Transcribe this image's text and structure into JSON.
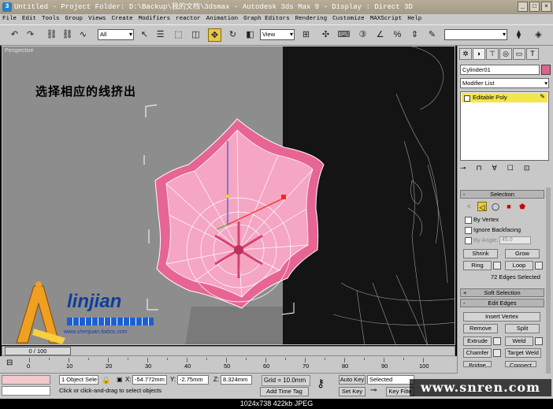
{
  "window": {
    "title": "Untitled     - Project Folder: D:\\Backup\\我的文档\\3dsmax     - Autodesk 3ds Max 9     - Display : Direct 3D",
    "controls": [
      "_",
      "□",
      "×"
    ]
  },
  "menu": [
    "File",
    "Edit",
    "Tools",
    "Group",
    "Views",
    "Create",
    "Modifiers",
    "reactor",
    "Animation",
    "Graph Editors",
    "Rendering",
    "Customize",
    "MAXScript",
    "Help"
  ],
  "toolbar": {
    "selection_filter": "All",
    "ref_coord": "View"
  },
  "viewport": {
    "label": "Perspective",
    "caption": "选择相应的线挤出"
  },
  "logo": {
    "text": "linjian",
    "url": "www.shenjuan.fwbos.com"
  },
  "command_panel": {
    "object_name": "Cylinder01",
    "modifier_list": "Modifier List",
    "stack_item": "Editable Poly",
    "selection": {
      "header": "Selection",
      "by_vertex": "By Vertex",
      "ignore_backfacing": "Ignore Backfacing",
      "by_angle": "By Angle:",
      "angle_value": "45.0",
      "shrink": "Shrink",
      "grow": "Grow",
      "ring": "Ring",
      "loop": "Loop",
      "info": "72 Edges Selected"
    },
    "soft_selection": "Soft Selection",
    "edit_edges": {
      "header": "Edit Edges",
      "insert_vertex": "Insert Vertex",
      "remove": "Remove",
      "split": "Split",
      "extrude": "Extrude",
      "weld": "Weld",
      "chamfer": "Chamfer",
      "target_weld": "Target Weld",
      "bridge": "Bridge",
      "connect": "Connect"
    }
  },
  "timeline": {
    "slider": "0 / 100",
    "ticks": [
      "0",
      "10",
      "20",
      "30",
      "40",
      "50",
      "60",
      "70",
      "80",
      "90",
      "100"
    ]
  },
  "status": {
    "object_count": "1 Object Sele",
    "x_label": "X:",
    "x_value": "-54.772mm",
    "y_label": "Y:",
    "y_value": "-2.75mm",
    "z_label": "Z:",
    "z_value": "8.324mm",
    "grid": "Grid = 10.0mm",
    "prompt": "Click or click-and-drag to select objects",
    "add_time_tag": "Add Time Tag",
    "auto_key": "Auto Key",
    "selected": "Selected",
    "set_key": "Set Key",
    "key_filters": "Key Filte"
  },
  "watermark": "www.snren.com",
  "image_caption": "1024x738  422kb  JPEG"
}
